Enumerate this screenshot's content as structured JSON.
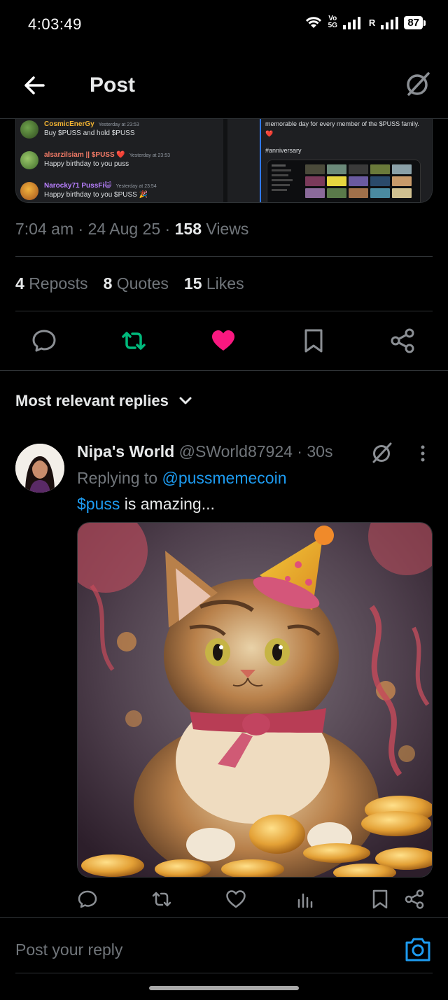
{
  "status_bar": {
    "time": "4:03:49",
    "net_top": "Vo",
    "net_bottom": "5G",
    "roaming": "R",
    "battery": "87"
  },
  "header": {
    "title": "Post"
  },
  "embed": {
    "messages": [
      {
        "name": "CosmicEnerGy",
        "time": "Yesterday at 23:53",
        "text": "Buy $PUSS and hold $PUSS",
        "color": "#f0b232"
      },
      {
        "name": "alsarzilsiam || $PUSS ❤️",
        "time": "Yesterday at 23:53",
        "text": "Happy birthday to you puss",
        "color": "#f47b67"
      },
      {
        "name": "Narocky71 PussFi😺",
        "time": "Yesterday at 23:54",
        "text": "Happy birthday to you $PUSS 🎉",
        "color": "#b980ff"
      }
    ],
    "right_text": "memorable day for every member of the $PUSS family. ❤️",
    "right_tag": "#anniversary"
  },
  "post_meta": {
    "time": "7:04 am",
    "date": "24 Aug 25",
    "views_count": "158",
    "views_label": "Views"
  },
  "stats": {
    "reposts_count": "4",
    "reposts_label": "Reposts",
    "quotes_count": "8",
    "quotes_label": "Quotes",
    "likes_count": "15",
    "likes_label": "Likes"
  },
  "colors": {
    "repost_active": "#00ba7c",
    "like_active": "#f91880",
    "link": "#1d9bf0"
  },
  "sort": {
    "label": "Most relevant replies"
  },
  "reply": {
    "name": "Nipa's World",
    "handle": "@SWorld87924",
    "time": "30s",
    "replying_prefix": "Replying to",
    "replying_to": "@pussmemecoin",
    "text_tag": "$puss",
    "text_rest": " is amazing..."
  },
  "compose": {
    "placeholder": "Post your reply"
  }
}
